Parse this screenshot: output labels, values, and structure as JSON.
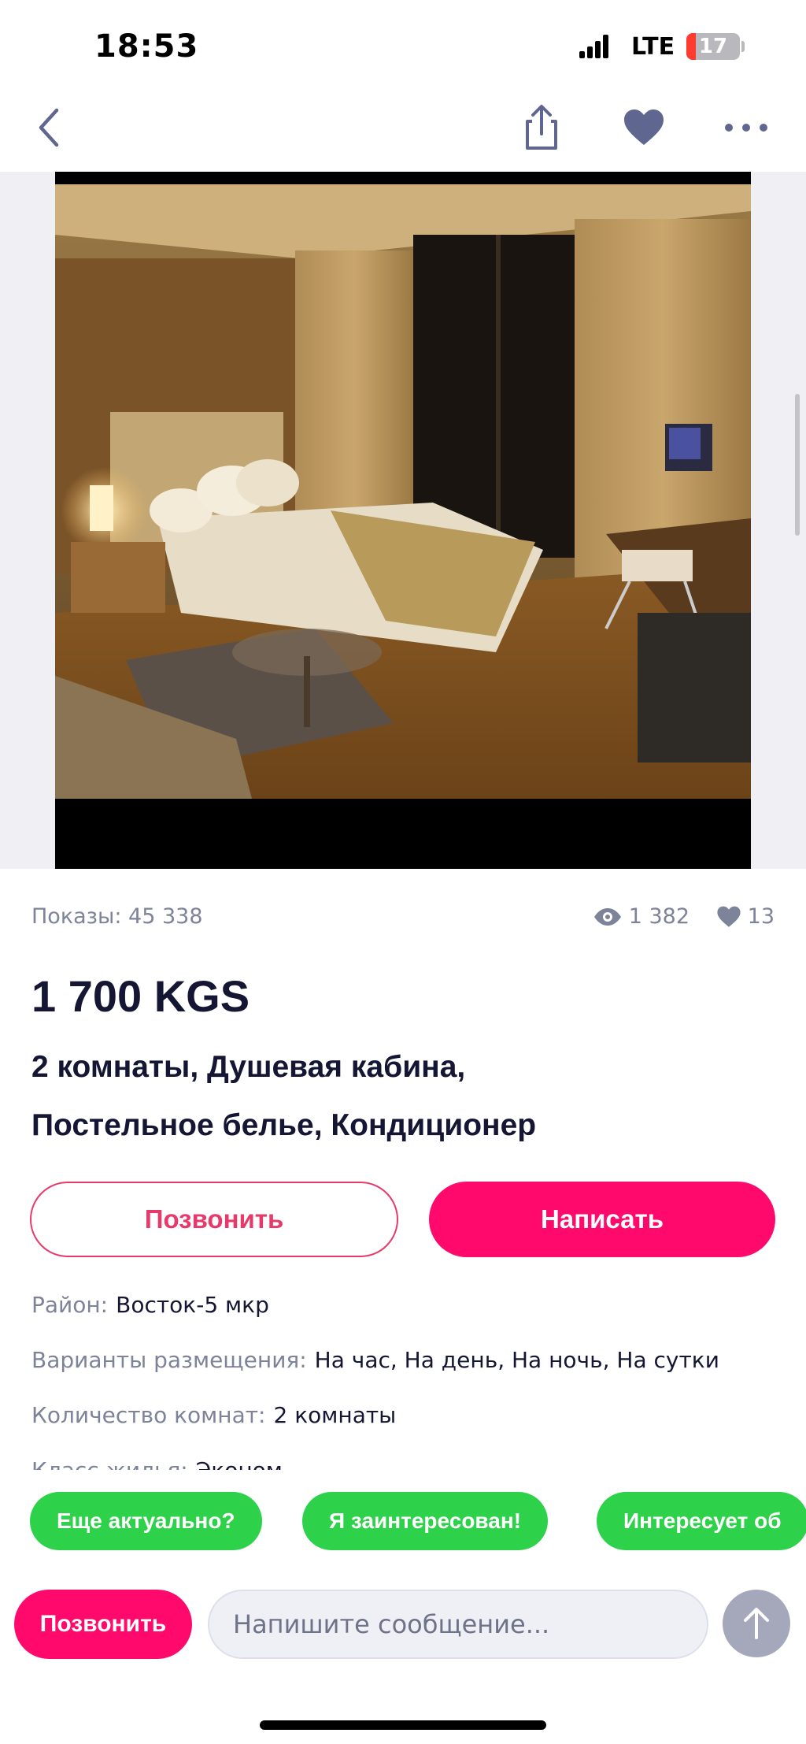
{
  "status_bar": {
    "time": "18:53",
    "network": "LTE",
    "battery_level": "17",
    "battery_fraction": 0.17,
    "battery_color": "#ff3b30"
  },
  "nav": {
    "back_icon": "chevron-left-icon",
    "share_icon": "share-icon",
    "favorite_icon": "heart-icon",
    "more_icon": "more-horizontal-icon",
    "icon_color": "#5f6791"
  },
  "gallery": {
    "image": "hotel-room-photo"
  },
  "stats": {
    "impressions": "Показы: 45 338",
    "views": "1 382",
    "likes": "13"
  },
  "listing": {
    "price": "1 700 KGS",
    "title_line1": "2 комнаты, Душевая кабина,",
    "title_line2": "Постельное белье, Кондиционер"
  },
  "actions": {
    "call_label": "Позвонить",
    "write_label": "Написать",
    "accent_color": "#ff0a6c"
  },
  "details": [
    {
      "key": "Район:",
      "value": "Восток-5 мкр"
    },
    {
      "key": "Варианты размещения:",
      "value": "На час, На день, На ночь, На сутки"
    },
    {
      "key": "Количество комнат:",
      "value": "2 комнаты"
    },
    {
      "key": "Класс жилья:",
      "value": "Эконом"
    }
  ],
  "quick_replies": [
    "Еще актуально?",
    "Я заинтересован!",
    "Интересует об"
  ],
  "chat": {
    "call_label": "Позвонить",
    "input_placeholder": "Напишите сообщение...",
    "send_icon": "arrow-up-icon"
  }
}
